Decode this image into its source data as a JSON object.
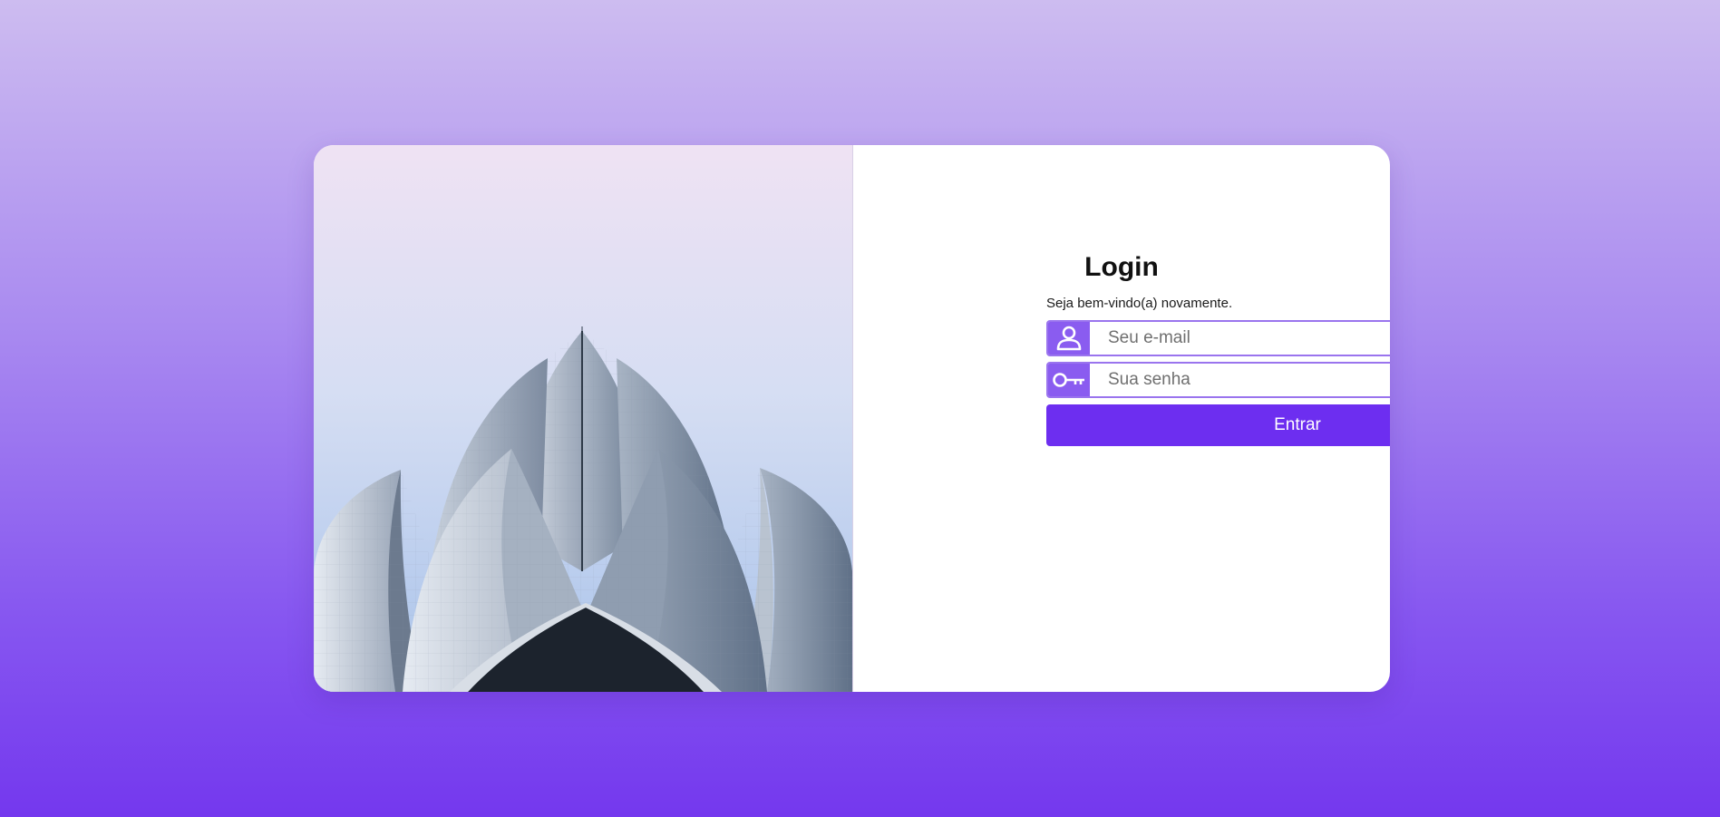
{
  "login": {
    "title": "Login",
    "welcome": "Seja bem-vindo(a) novamente.",
    "email": {
      "icon": "user-icon",
      "placeholder": "Seu e-mail",
      "value": ""
    },
    "password": {
      "icon": "key-icon",
      "placeholder": "Sua senha",
      "value": ""
    },
    "submit_label": "Entrar"
  },
  "colors": {
    "accent": "#6d2ef0",
    "icon_bg": "#8a5cf0",
    "field_border": "#9a74ee",
    "page_gradient_top": "#cdbcf0",
    "page_gradient_bottom": "#7438ee"
  }
}
